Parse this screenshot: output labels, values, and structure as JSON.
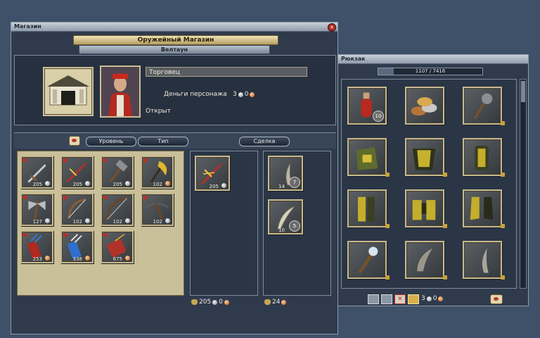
{
  "shop_window": {
    "title": "Магазин",
    "shop_name": "Оружейный Магазин",
    "town": "Велтаун",
    "trader_name": "Торговец",
    "money_label": "Деньги персонажа",
    "money_gold": "3",
    "money_silver": "0",
    "status": "Открыт",
    "tabs": [
      "Уровень",
      "Тип",
      "Сделка"
    ],
    "items": [
      {
        "name": "dagger-icon",
        "price": "205",
        "coin": "silver"
      },
      {
        "name": "sword-icon",
        "price": "205",
        "coin": "silver"
      },
      {
        "name": "hammer-icon",
        "price": "205",
        "coin": "silver"
      },
      {
        "name": "golden-axe-icon",
        "price": "102",
        "coin": "copper"
      },
      {
        "name": "battle-axe-icon",
        "price": "127",
        "coin": "silver"
      },
      {
        "name": "bow-icon",
        "price": "102",
        "coin": "silver"
      },
      {
        "name": "longbow-icon",
        "price": "102",
        "coin": "silver"
      },
      {
        "name": "crossbow-icon",
        "price": "102",
        "coin": "silver"
      },
      {
        "name": "red-quiver-icon",
        "price": "253",
        "coin": "copper"
      },
      {
        "name": "blue-quiver-icon",
        "price": "338",
        "coin": "copper"
      },
      {
        "name": "scabbard-icon",
        "price": "675",
        "coin": "copper"
      }
    ],
    "selected_item": {
      "name": "sword-icon",
      "price": "205",
      "coin": "silver"
    },
    "trade_items": [
      {
        "name": "horn-icon",
        "price": "14",
        "count": "7"
      },
      {
        "name": "claw-icon",
        "price": "10",
        "count": "5"
      }
    ],
    "total_left": {
      "gold": "205",
      "silver": "0"
    },
    "total_right": {
      "gold": "24"
    }
  },
  "backpack_window": {
    "title": "Рюкзак",
    "capacity": "1107 / 7416",
    "capacity_fraction": 0.149,
    "items": [
      {
        "name": "red-potion-icon",
        "count": "10"
      },
      {
        "name": "coins-pile-icon"
      },
      {
        "name": "mace-icon"
      },
      {
        "name": "backpack-armor-icon"
      },
      {
        "name": "chest-armor-icon"
      },
      {
        "name": "bracer-icon"
      },
      {
        "name": "leg-armor-icon"
      },
      {
        "name": "belt-armor-icon"
      },
      {
        "name": "boots-icon"
      },
      {
        "name": "torch-icon"
      },
      {
        "name": "horn-item-icon"
      },
      {
        "name": "fang-item-icon"
      }
    ],
    "money_gold": "3",
    "money_silver": "0"
  },
  "colors": {
    "silver": "#c7cad0",
    "copper": "#e07a3a",
    "gold": "#d9b24a",
    "frame": "#cdbd94"
  }
}
